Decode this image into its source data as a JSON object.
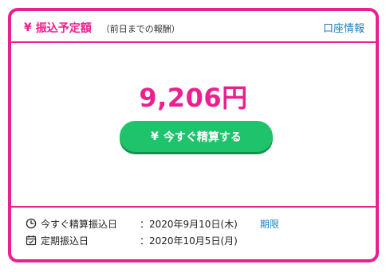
{
  "header": {
    "yen_symbol": "¥",
    "title": "振込予定額",
    "subtitle": "（前日までの報酬）",
    "account_link": "口座情報"
  },
  "amount": "9,206円",
  "settle_button": {
    "yen_symbol": "¥",
    "label": "今すぐ精算する"
  },
  "schedule": {
    "instant": {
      "icon": "clock-icon",
      "label": "今すぐ精算振込日",
      "date": "：2020年9月10日(木)",
      "deadline_link": "期限"
    },
    "regular": {
      "icon": "calendar-icon",
      "label": "定期振込日",
      "date": "：2020年10月5日(月)"
    }
  },
  "colors": {
    "accent": "#ec1f8e",
    "button": "#1ec36b",
    "link": "#1e7fb8"
  }
}
